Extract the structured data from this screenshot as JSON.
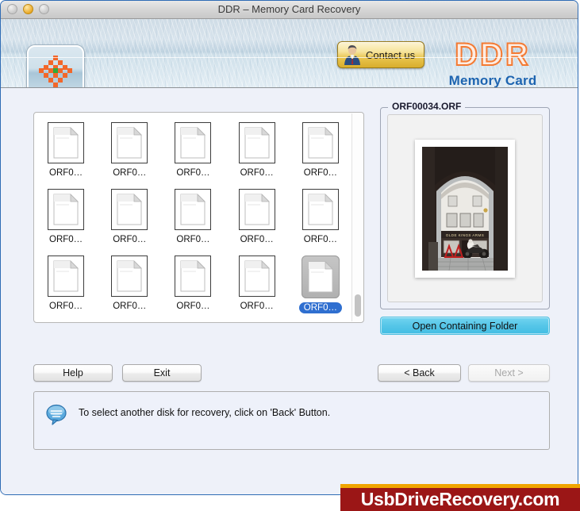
{
  "window": {
    "title": "DDR – Memory Card Recovery",
    "controls": {
      "close": "close-button",
      "minimize": "minimize-button",
      "zoom": "zoom-button"
    }
  },
  "header": {
    "logo_icon": "checkered-star-logo",
    "contact": {
      "label": "Contact us",
      "icon": "person-avatar-icon"
    },
    "brand": {
      "title": "DDR",
      "subtitle": "Memory Card",
      "title_color": "#f47a32",
      "subtitle_color": "#1d64b0"
    }
  },
  "file_list": {
    "items": [
      {
        "label": "ORF0…",
        "icon": "document-icon",
        "selected": false
      },
      {
        "label": "ORF0…",
        "icon": "document-icon",
        "selected": false
      },
      {
        "label": "ORF0…",
        "icon": "document-icon",
        "selected": false
      },
      {
        "label": "ORF0…",
        "icon": "document-icon",
        "selected": false
      },
      {
        "label": "ORF0…",
        "icon": "document-icon",
        "selected": false
      },
      {
        "label": "ORF0…",
        "icon": "document-icon",
        "selected": false
      },
      {
        "label": "ORF0…",
        "icon": "document-icon",
        "selected": false
      },
      {
        "label": "ORF0…",
        "icon": "document-icon",
        "selected": false
      },
      {
        "label": "ORF0…",
        "icon": "document-icon",
        "selected": false
      },
      {
        "label": "ORF0…",
        "icon": "document-icon",
        "selected": false
      },
      {
        "label": "ORF0…",
        "icon": "document-icon",
        "selected": false
      },
      {
        "label": "ORF0…",
        "icon": "document-icon",
        "selected": false
      },
      {
        "label": "ORF0…",
        "icon": "document-icon",
        "selected": false
      },
      {
        "label": "ORF0…",
        "icon": "document-icon",
        "selected": false
      },
      {
        "label": "ORF0…",
        "icon": "document-icon",
        "selected": true
      }
    ],
    "selection_color": "#2f6fd0"
  },
  "preview": {
    "legend": "ORF00034.ORF",
    "image_alt": "photograph of a pub storefront seen through a stone archway with a motorcycle parked outside",
    "open_folder_label": "Open Containing Folder",
    "open_folder_color": "#55c6e8"
  },
  "nav": {
    "help_label": "Help",
    "exit_label": "Exit",
    "back_label": "< Back",
    "next_label": "Next >",
    "next_enabled": false
  },
  "status": {
    "icon": "speech-bubble-icon",
    "message": "To select another disk for recovery, click on 'Back' Button."
  },
  "footer": {
    "text": "UsbDriveRecovery.com",
    "background_color": "#9b1616",
    "stripe_color": "#f0a500"
  }
}
